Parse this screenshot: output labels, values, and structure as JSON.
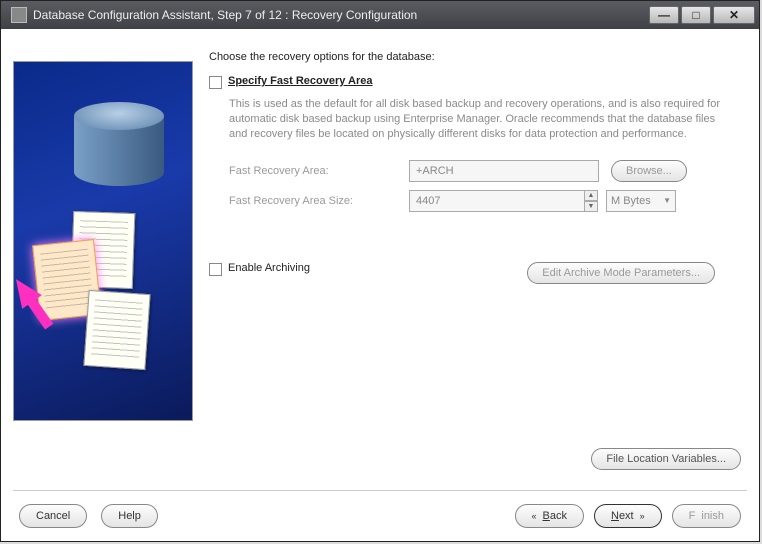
{
  "window": {
    "title": "Database Configuration Assistant, Step 7 of 12 : Recovery Configuration"
  },
  "main": {
    "heading": "Choose the recovery options for the database:",
    "specifyCheckbox": "Specify Fast Recovery Area",
    "description": "This is used as the default for all disk based backup and recovery operations, and is also required for automatic disk based backup using Enterprise Manager. Oracle recommends that the database files and recovery files be located on physically different disks for data protection and performance.",
    "fraLabel": "Fast Recovery Area:",
    "fraValue": "+ARCH",
    "browse": "Browse...",
    "fraSizeLabel": "Fast Recovery Area Size:",
    "fraSizeValue": "4407",
    "fraSizeUnit": "M Bytes",
    "enableArchiving": "Enable Archiving",
    "editArchive": "Edit Archive Mode Parameters...",
    "fileLocVars": "File Location Variables..."
  },
  "footer": {
    "cancel": "Cancel",
    "help": "Help",
    "back": "Back",
    "next": "Next",
    "finish": "Finish"
  }
}
